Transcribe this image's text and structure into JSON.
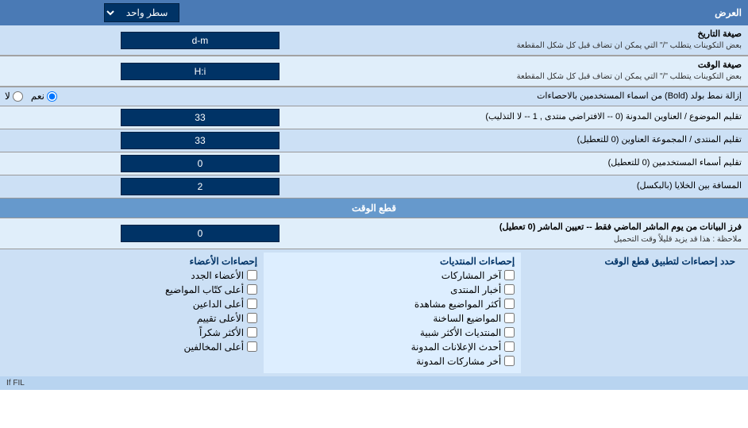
{
  "header": {
    "label": "العرض",
    "dropdown_label": "سطر واحد"
  },
  "rows": [
    {
      "id": "date_format",
      "label": "صيغة التاريخ",
      "sublabel": "بعض التكوينات يتطلب \"/\" التي يمكن ان تضاف قبل كل شكل المقطعة",
      "input_value": "d-m",
      "type": "text"
    },
    {
      "id": "time_format",
      "label": "صيغة الوقت",
      "sublabel": "بعض التكوينات يتطلب \"/\" التي يمكن ان تضاف قبل كل شكل المقطعة",
      "input_value": "H:i",
      "type": "text"
    },
    {
      "id": "bold_remove",
      "label": "إزالة نمط بولد (Bold) من اسماء المستخدمين بالاحصاءات",
      "input_value": "",
      "type": "radio",
      "radio_options": [
        "نعم",
        "لا"
      ],
      "radio_selected": "نعم"
    },
    {
      "id": "subject_order",
      "label": "تقليم الموضوع / العناوين المدونة (0 -- الافتراضي منتدى , 1 -- لا التذليب)",
      "input_value": "33",
      "type": "text"
    },
    {
      "id": "forum_order",
      "label": "تقليم المنتدى / المجموعة العناوين (0 للتعطيل)",
      "input_value": "33",
      "type": "text"
    },
    {
      "id": "users_order",
      "label": "تقليم أسماء المستخدمين (0 للتعطيل)",
      "input_value": "0",
      "type": "text"
    },
    {
      "id": "cell_distance",
      "label": "المسافة بين الخلايا (بالبكسل)",
      "input_value": "2",
      "type": "text"
    }
  ],
  "cut_section": {
    "title": "قطع الوقت",
    "row": {
      "label": "فرز البيانات من يوم الماشر الماضي فقط -- تعيين الماشر (0 تعطيل)",
      "note": "ملاحظة : هذا قد يزيد قليلاً وقت التحميل",
      "input_value": "0"
    }
  },
  "stats_section": {
    "title": "حدد إحصاءات لتطبيق قطع الوقت",
    "col1_title": "إحصاءات المنتديات",
    "col1_items": [
      "آخر المشاركات",
      "أخبار المنتدى",
      "أكثر المواضيع مشاهدة",
      "المواضيع الساخنة",
      "المنتديات الأكثر شبية",
      "أحدث الإعلانات المدونة",
      "أخر مشاركات المدونة"
    ],
    "col2_title": "إحصاءات الأعضاء",
    "col2_items": [
      "الأعضاء الجدد",
      "أعلى كتّاب المواضيع",
      "أعلى الداعين",
      "الأعلى تقييم",
      "الأكثر شكراً",
      "أعلى المخالفين"
    ],
    "col3_title": "",
    "col3_items": []
  }
}
